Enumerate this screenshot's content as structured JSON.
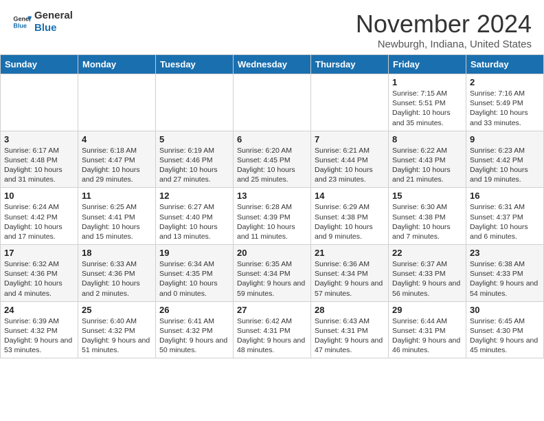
{
  "logo": {
    "line1": "General",
    "line2": "Blue"
  },
  "title": "November 2024",
  "location": "Newburgh, Indiana, United States",
  "days_of_week": [
    "Sunday",
    "Monday",
    "Tuesday",
    "Wednesday",
    "Thursday",
    "Friday",
    "Saturday"
  ],
  "weeks": [
    [
      {
        "day": "",
        "info": ""
      },
      {
        "day": "",
        "info": ""
      },
      {
        "day": "",
        "info": ""
      },
      {
        "day": "",
        "info": ""
      },
      {
        "day": "",
        "info": ""
      },
      {
        "day": "1",
        "info": "Sunrise: 7:15 AM\nSunset: 5:51 PM\nDaylight: 10 hours and 35 minutes."
      },
      {
        "day": "2",
        "info": "Sunrise: 7:16 AM\nSunset: 5:49 PM\nDaylight: 10 hours and 33 minutes."
      }
    ],
    [
      {
        "day": "3",
        "info": "Sunrise: 6:17 AM\nSunset: 4:48 PM\nDaylight: 10 hours and 31 minutes."
      },
      {
        "day": "4",
        "info": "Sunrise: 6:18 AM\nSunset: 4:47 PM\nDaylight: 10 hours and 29 minutes."
      },
      {
        "day": "5",
        "info": "Sunrise: 6:19 AM\nSunset: 4:46 PM\nDaylight: 10 hours and 27 minutes."
      },
      {
        "day": "6",
        "info": "Sunrise: 6:20 AM\nSunset: 4:45 PM\nDaylight: 10 hours and 25 minutes."
      },
      {
        "day": "7",
        "info": "Sunrise: 6:21 AM\nSunset: 4:44 PM\nDaylight: 10 hours and 23 minutes."
      },
      {
        "day": "8",
        "info": "Sunrise: 6:22 AM\nSunset: 4:43 PM\nDaylight: 10 hours and 21 minutes."
      },
      {
        "day": "9",
        "info": "Sunrise: 6:23 AM\nSunset: 4:42 PM\nDaylight: 10 hours and 19 minutes."
      }
    ],
    [
      {
        "day": "10",
        "info": "Sunrise: 6:24 AM\nSunset: 4:42 PM\nDaylight: 10 hours and 17 minutes."
      },
      {
        "day": "11",
        "info": "Sunrise: 6:25 AM\nSunset: 4:41 PM\nDaylight: 10 hours and 15 minutes."
      },
      {
        "day": "12",
        "info": "Sunrise: 6:27 AM\nSunset: 4:40 PM\nDaylight: 10 hours and 13 minutes."
      },
      {
        "day": "13",
        "info": "Sunrise: 6:28 AM\nSunset: 4:39 PM\nDaylight: 10 hours and 11 minutes."
      },
      {
        "day": "14",
        "info": "Sunrise: 6:29 AM\nSunset: 4:38 PM\nDaylight: 10 hours and 9 minutes."
      },
      {
        "day": "15",
        "info": "Sunrise: 6:30 AM\nSunset: 4:38 PM\nDaylight: 10 hours and 7 minutes."
      },
      {
        "day": "16",
        "info": "Sunrise: 6:31 AM\nSunset: 4:37 PM\nDaylight: 10 hours and 6 minutes."
      }
    ],
    [
      {
        "day": "17",
        "info": "Sunrise: 6:32 AM\nSunset: 4:36 PM\nDaylight: 10 hours and 4 minutes."
      },
      {
        "day": "18",
        "info": "Sunrise: 6:33 AM\nSunset: 4:36 PM\nDaylight: 10 hours and 2 minutes."
      },
      {
        "day": "19",
        "info": "Sunrise: 6:34 AM\nSunset: 4:35 PM\nDaylight: 10 hours and 0 minutes."
      },
      {
        "day": "20",
        "info": "Sunrise: 6:35 AM\nSunset: 4:34 PM\nDaylight: 9 hours and 59 minutes."
      },
      {
        "day": "21",
        "info": "Sunrise: 6:36 AM\nSunset: 4:34 PM\nDaylight: 9 hours and 57 minutes."
      },
      {
        "day": "22",
        "info": "Sunrise: 6:37 AM\nSunset: 4:33 PM\nDaylight: 9 hours and 56 minutes."
      },
      {
        "day": "23",
        "info": "Sunrise: 6:38 AM\nSunset: 4:33 PM\nDaylight: 9 hours and 54 minutes."
      }
    ],
    [
      {
        "day": "24",
        "info": "Sunrise: 6:39 AM\nSunset: 4:32 PM\nDaylight: 9 hours and 53 minutes."
      },
      {
        "day": "25",
        "info": "Sunrise: 6:40 AM\nSunset: 4:32 PM\nDaylight: 9 hours and 51 minutes."
      },
      {
        "day": "26",
        "info": "Sunrise: 6:41 AM\nSunset: 4:32 PM\nDaylight: 9 hours and 50 minutes."
      },
      {
        "day": "27",
        "info": "Sunrise: 6:42 AM\nSunset: 4:31 PM\nDaylight: 9 hours and 48 minutes."
      },
      {
        "day": "28",
        "info": "Sunrise: 6:43 AM\nSunset: 4:31 PM\nDaylight: 9 hours and 47 minutes."
      },
      {
        "day": "29",
        "info": "Sunrise: 6:44 AM\nSunset: 4:31 PM\nDaylight: 9 hours and 46 minutes."
      },
      {
        "day": "30",
        "info": "Sunrise: 6:45 AM\nSunset: 4:30 PM\nDaylight: 9 hours and 45 minutes."
      }
    ]
  ]
}
